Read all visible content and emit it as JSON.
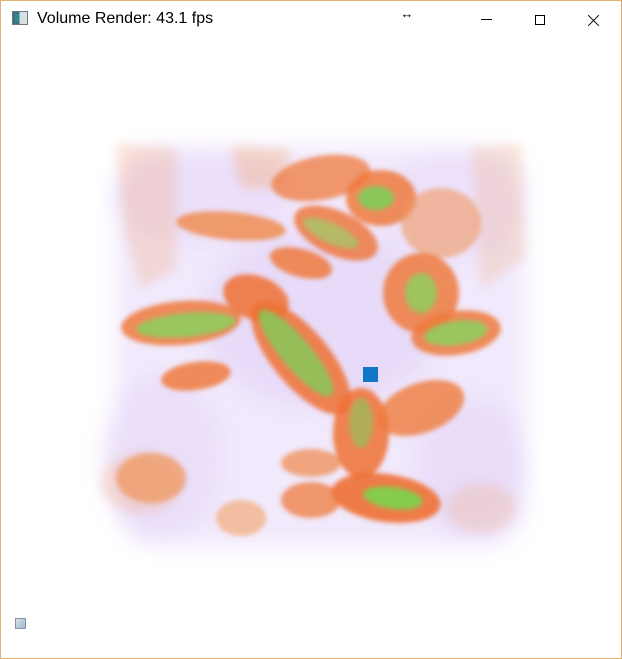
{
  "window": {
    "title": "Volume Render: 43.1 fps",
    "app_icon": "app-window-icon",
    "resize_indicator_icon": "horizontal-resize-arrow-icon",
    "controls": {
      "minimize_icon": "minimize-icon",
      "maximize_icon": "maximize-icon",
      "close_icon": "close-icon"
    },
    "border_color": "#e0b070"
  },
  "viewport": {
    "background": "#ffffff",
    "volume_colors": {
      "haze": "#c8a6f2",
      "orange": "#ef7a3c",
      "orange_light": "#f3a064",
      "green": "#84c95a",
      "probe": "#1178c8"
    },
    "corner_widget_icon": "orientation-widget-icon"
  }
}
